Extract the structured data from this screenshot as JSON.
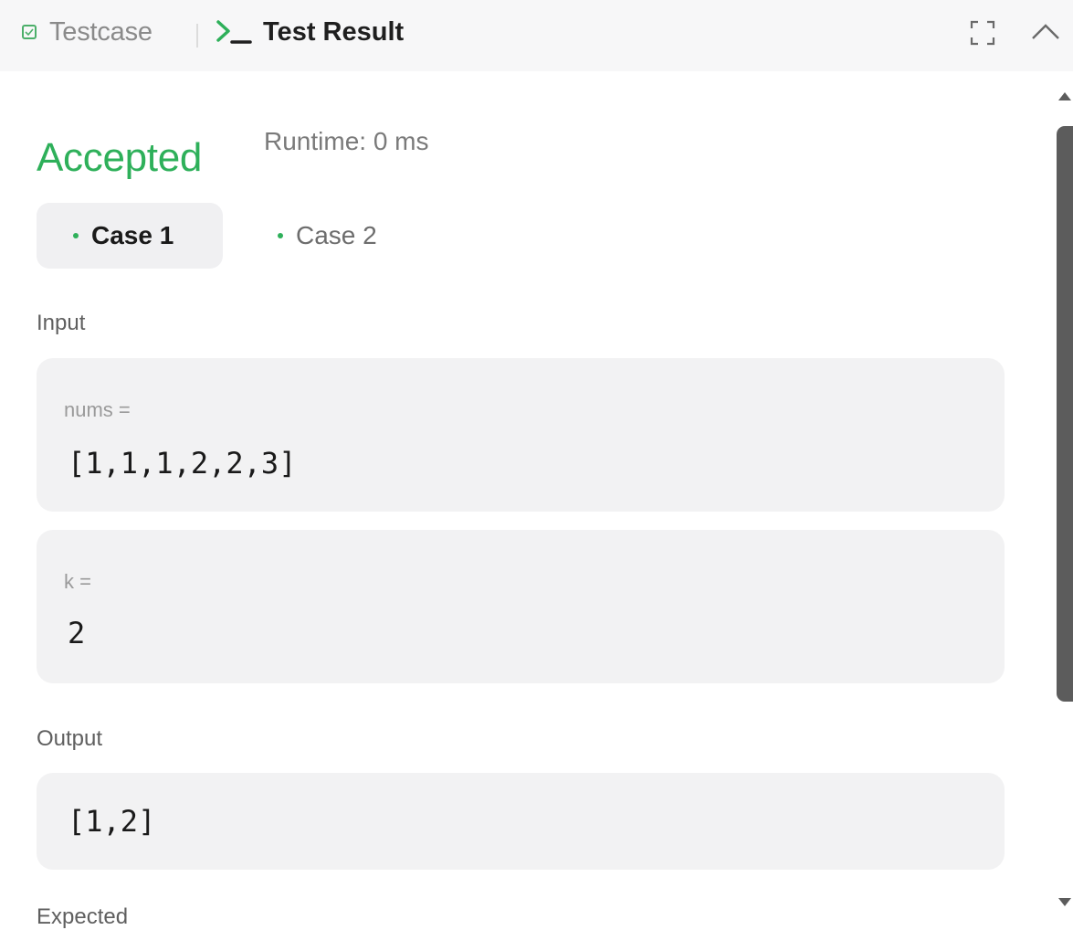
{
  "header": {
    "testcase_tab": "Testcase",
    "result_tab": "Test Result",
    "accent": "#4caf6a"
  },
  "icons": [
    "check-square-icon",
    "terminal-icon",
    "expand-icon",
    "chevron-up-icon"
  ],
  "result": {
    "status": "Accepted",
    "runtime": "Runtime: 0 ms",
    "status_color": "#2eb05a"
  },
  "cases": [
    {
      "label": "Case 1",
      "active": true
    },
    {
      "label": "Case 2",
      "active": false
    }
  ],
  "input": {
    "label": "Input",
    "params": [
      {
        "name": "nums =",
        "value": "[1,1,1,2,2,3]"
      },
      {
        "name": "k =",
        "value": "2"
      }
    ]
  },
  "output": {
    "label": "Output",
    "value": "[1,2]"
  },
  "expected": {
    "label": "Expected"
  }
}
